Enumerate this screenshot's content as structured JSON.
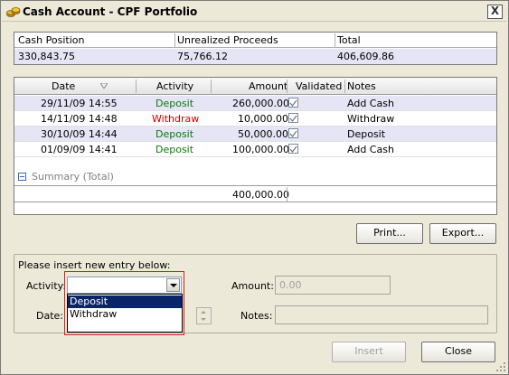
{
  "window": {
    "title": "Cash Account - CPF Portfolio",
    "close_label": "X"
  },
  "cash": {
    "headers": [
      "Cash Position",
      "Unrealized Proceeds",
      "Total"
    ],
    "values": [
      "330,843.75",
      "75,766.12",
      "406,609.86"
    ]
  },
  "transactions": {
    "headers": {
      "date": "Date",
      "activity": "Activity",
      "amount": "Amount",
      "validated": "Validated",
      "notes": "Notes"
    },
    "rows": [
      {
        "date": "29/11/09 14:55",
        "activity": "Deposit",
        "amount": "260,000.00",
        "notes": "Add Cash"
      },
      {
        "date": "14/11/09 14:48",
        "activity": "Withdraw",
        "amount": "10,000.00",
        "notes": "Withdraw"
      },
      {
        "date": "30/10/09 14:44",
        "activity": "Deposit",
        "amount": "50,000.00",
        "notes": "Deposit"
      },
      {
        "date": "01/09/09 14:41",
        "activity": "Deposit",
        "amount": "100,000.00",
        "notes": "Add Cash"
      }
    ],
    "summary_label": "Summary (Total)",
    "summary_total": "400,000.00"
  },
  "buttons": {
    "print": "Print...",
    "export": "Export...",
    "insert": "Insert",
    "close": "Close"
  },
  "entry": {
    "group_label": "Please insert new entry below:",
    "activity_label": "Activity:",
    "amount_label": "Amount:",
    "amount_value": "0.00",
    "date_label": "Date:",
    "notes_label": "Notes:",
    "activity_options": [
      "Deposit",
      "Withdraw"
    ],
    "activity_highlighted": "Deposit"
  },
  "colors": {
    "deposit": "#0a7a0a",
    "withdraw": "#cc0000",
    "selection": "#0a246a",
    "annotation_box": "#d81e1e"
  }
}
